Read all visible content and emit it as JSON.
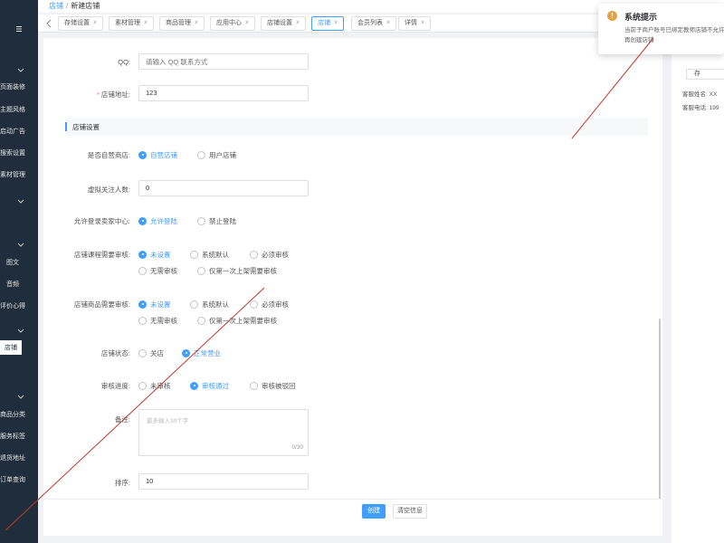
{
  "breadcrumb": {
    "parent": "店铺",
    "separator": "/",
    "current": "新建店铺"
  },
  "tabs": [
    {
      "label": "存储设置",
      "active": false
    },
    {
      "label": "素材管理",
      "active": false
    },
    {
      "label": "商品管理",
      "active": false
    },
    {
      "label": "应用中心",
      "active": false
    },
    {
      "label": "店铺设置",
      "active": false
    },
    {
      "label": "店铺",
      "active": true
    },
    {
      "label": "会员列表",
      "active": false
    },
    {
      "label": "详情",
      "active": false
    }
  ],
  "tab_close_glyph": "×",
  "sidebar": {
    "items": [
      "页面装修",
      "主题风格",
      "启动广告",
      "搜索设置",
      "素材管理",
      "图文",
      "音频",
      "评价心得",
      "店铺",
      "商品分类",
      "服务标签",
      "退货地址",
      "订单查询"
    ],
    "active": "店铺"
  },
  "form": {
    "qq": {
      "label": "QQ:",
      "placeholder": "请输入 QQ 联系方式"
    },
    "address": {
      "required_mark": "*",
      "label": "店铺地址:",
      "value": "123"
    },
    "section_title": "店铺设置",
    "self_operated": {
      "label": "是否自营商店:",
      "options": [
        "自营店铺",
        "用户店铺"
      ],
      "selected": 0
    },
    "followers": {
      "label": "虚拟关注人数:",
      "value": "0"
    },
    "seller_center": {
      "label": "允许登录卖家中心:",
      "options": [
        "允许登陆",
        "禁止登陆"
      ],
      "selected": 0
    },
    "course_review": {
      "label": "店铺课程需要审核:",
      "options": [
        "未设置",
        "系统默认",
        "必须审核",
        "无需审核",
        "仅第一次上架需要审核"
      ],
      "selected": 0
    },
    "goods_review": {
      "label": "店铺商品需要审核:",
      "options": [
        "未设置",
        "系统默认",
        "必须审核",
        "无需审核",
        "仅第一次上架需要审核"
      ],
      "selected": 0
    },
    "status": {
      "label": "店铺状态:",
      "options": [
        "关店",
        "正常营业"
      ],
      "selected": 1
    },
    "audit": {
      "label": "审核进度:",
      "options": [
        "未审核",
        "审核通过",
        "审核被驳回"
      ],
      "selected": 1
    },
    "remark": {
      "label": "备注:",
      "placeholder": "最多输入30个字",
      "counter": "0/30"
    },
    "sort": {
      "label": "排序:",
      "value": "10"
    }
  },
  "actions": {
    "create": "创建",
    "clear": "清空信息"
  },
  "right_panel": {
    "button": "存",
    "service_name": "客服姓名: XX",
    "service_phone": "客服电话: 199"
  },
  "notification": {
    "title": "系统提示",
    "message": "当前子商户账号已绑定教师店铺不允许再创建店铺"
  },
  "colors": {
    "sidebar": "#1f2d3d",
    "primary": "#409eff",
    "warning": "#e6a23c",
    "annotation": "#c0392b"
  }
}
